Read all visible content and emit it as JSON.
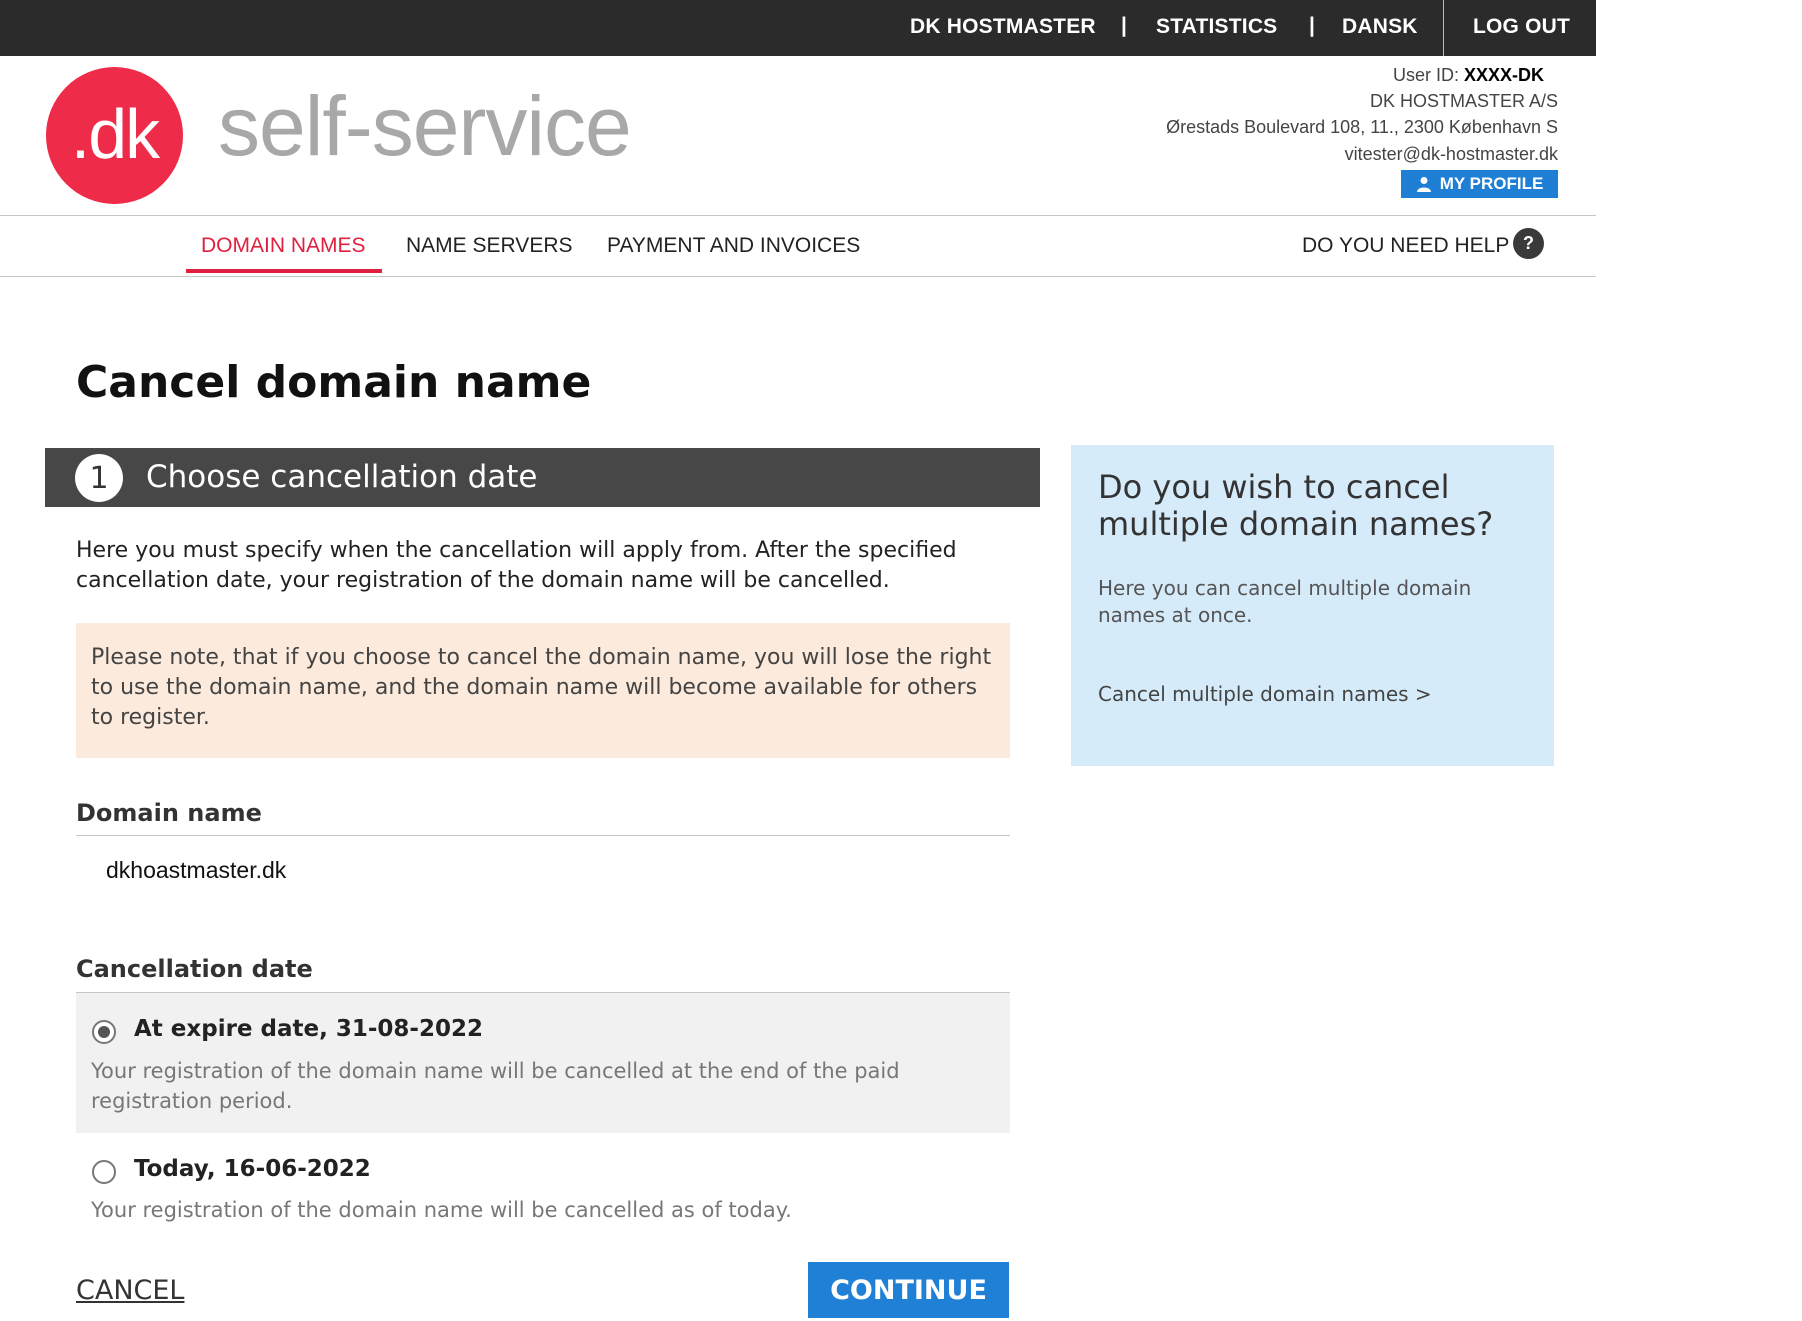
{
  "topbar": {
    "links": [
      "DK HOSTMASTER",
      "STATISTICS",
      "DANSK",
      "LOG OUT"
    ],
    "separator": "|"
  },
  "logo": {
    "text": ".dk",
    "brand": "self-service"
  },
  "account": {
    "user_id_label": "User ID:",
    "user_id": "XXXX-DK",
    "company": "DK HOSTMASTER A/S",
    "address": "Ørestads Boulevard 108, 11., 2300 København S",
    "email": "vitester@dk-hostmaster.dk",
    "profile_button": "MY PROFILE"
  },
  "nav": {
    "items": [
      "DOMAIN NAMES",
      "NAME SERVERS",
      "PAYMENT AND INVOICES"
    ],
    "active": "DOMAIN NAMES",
    "help": "DO YOU NEED HELP",
    "help_icon": "?"
  },
  "page": {
    "title": "Cancel domain name",
    "step_number": "1",
    "step_title": "Choose cancellation date",
    "intro": "Here you must specify when the cancellation will apply from. After the specified cancellation date, your registration of the domain name will be cancelled.",
    "notice": "Please note, that if you choose to cancel the domain name, you will lose the right to use the domain name, and the domain name will become available for others to register.",
    "domain_label": "Domain name",
    "domain_value": "dkhoastmaster.dk",
    "date_label": "Cancellation date",
    "options": [
      {
        "title": "At expire date, 31-08-2022",
        "description": "Your registration of the domain name will be cancelled at the end of the paid registration period.",
        "selected": true
      },
      {
        "title": "Today, 16-06-2022",
        "description": "Your registration of the domain name will be cancelled as of today.",
        "selected": false
      }
    ],
    "cancel_label": "CANCEL",
    "continue_label": "CONTINUE"
  },
  "sidebar": {
    "heading": "Do you wish to cancel multiple domain names?",
    "text": "Here you can cancel multiple domain names at once.",
    "link": "Cancel multiple domain names >"
  },
  "colors": {
    "accent_red": "#e02040",
    "button_blue": "#1f80d6",
    "notice_bg": "#fcebdc",
    "sidebar_bg": "#d6ebfa"
  }
}
